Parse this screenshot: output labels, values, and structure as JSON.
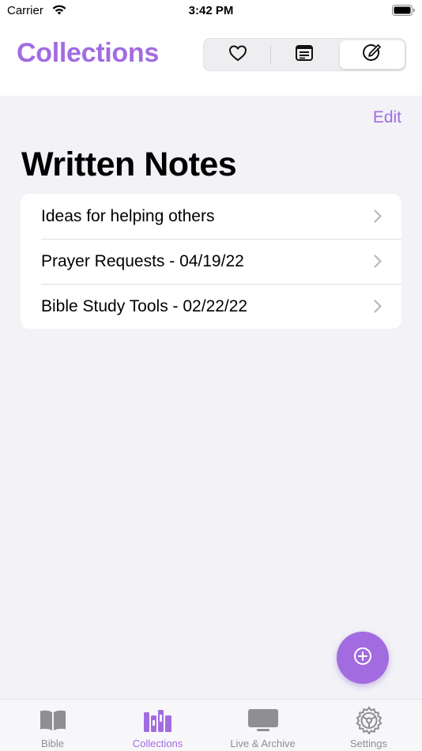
{
  "status_bar": {
    "carrier": "Carrier",
    "time": "3:42 PM"
  },
  "header": {
    "title": "Collections",
    "segments": [
      {
        "icon": "heart-icon",
        "selected": false
      },
      {
        "icon": "note-icon",
        "selected": false
      },
      {
        "icon": "written-note-icon",
        "selected": true
      }
    ]
  },
  "edit_label": "Edit",
  "section": {
    "title": "Written Notes",
    "items": [
      {
        "label": "Ideas for helping others"
      },
      {
        "label": "Prayer Requests - 04/19/22"
      },
      {
        "label": "Bible Study Tools - 02/22/22"
      }
    ]
  },
  "fab": {
    "icon": "add-circle-icon"
  },
  "tab_bar": {
    "tabs": [
      {
        "label": "Bible",
        "icon": "book-icon",
        "active": false
      },
      {
        "label": "Collections",
        "icon": "books-icon",
        "active": true
      },
      {
        "label": "Live & Archive",
        "icon": "tv-icon",
        "active": false
      },
      {
        "label": "Settings",
        "icon": "gear-icon",
        "active": false
      }
    ]
  },
  "colors": {
    "accent": "#a26ce0",
    "background": "#f2f2f7",
    "inactive": "#8e8e93"
  }
}
